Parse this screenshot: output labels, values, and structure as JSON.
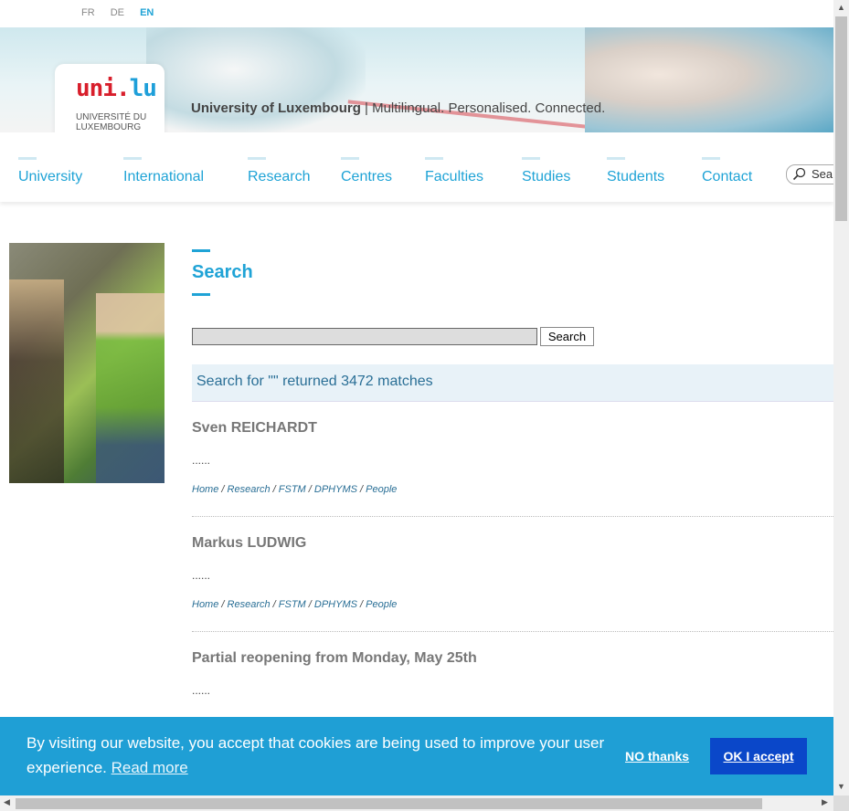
{
  "languages": [
    "FR",
    "DE",
    "EN"
  ],
  "active_language": "EN",
  "logo": {
    "mark_main": "uni.",
    "mark_accent": "lu",
    "sub1": "UNIVERSITÉ DU",
    "sub2": "LUXEMBOURG"
  },
  "tagline": {
    "brand": "University of Luxembourg",
    "rest": " | Multilingual. Personalised. Connected."
  },
  "nav": {
    "items": [
      "University",
      "International",
      "Research",
      "Centres",
      "Faculties",
      "Studies",
      "Students",
      "Contact"
    ],
    "search_label": "Sea"
  },
  "page": {
    "title": "Search"
  },
  "search": {
    "value": "",
    "button_label": "Search"
  },
  "summary": "Search for \"\" returned 3472 matches",
  "results": [
    {
      "title": "Sven REICHARDT",
      "snippet": "......",
      "breadcrumb": [
        "Home",
        "Research",
        "FSTM",
        "DPHYMS",
        "People"
      ]
    },
    {
      "title": "Markus LUDWIG",
      "snippet": "......",
      "breadcrumb": [
        "Home",
        "Research",
        "FSTM",
        "DPHYMS",
        "People"
      ]
    },
    {
      "title": "Partial reopening from Monday, May 25th",
      "snippet": "......",
      "breadcrumb": []
    }
  ],
  "cookie": {
    "message": "By visiting our website, you accept that cookies are being used to improve your user experience.",
    "read_more": "Read more",
    "decline": "NO thanks",
    "accept": "OK I accept",
    "bg_color": "#1f9fd5",
    "accept_color": "#0a47c9"
  },
  "colors": {
    "accent": "#1fa3d6",
    "link": "#2a6f96"
  }
}
